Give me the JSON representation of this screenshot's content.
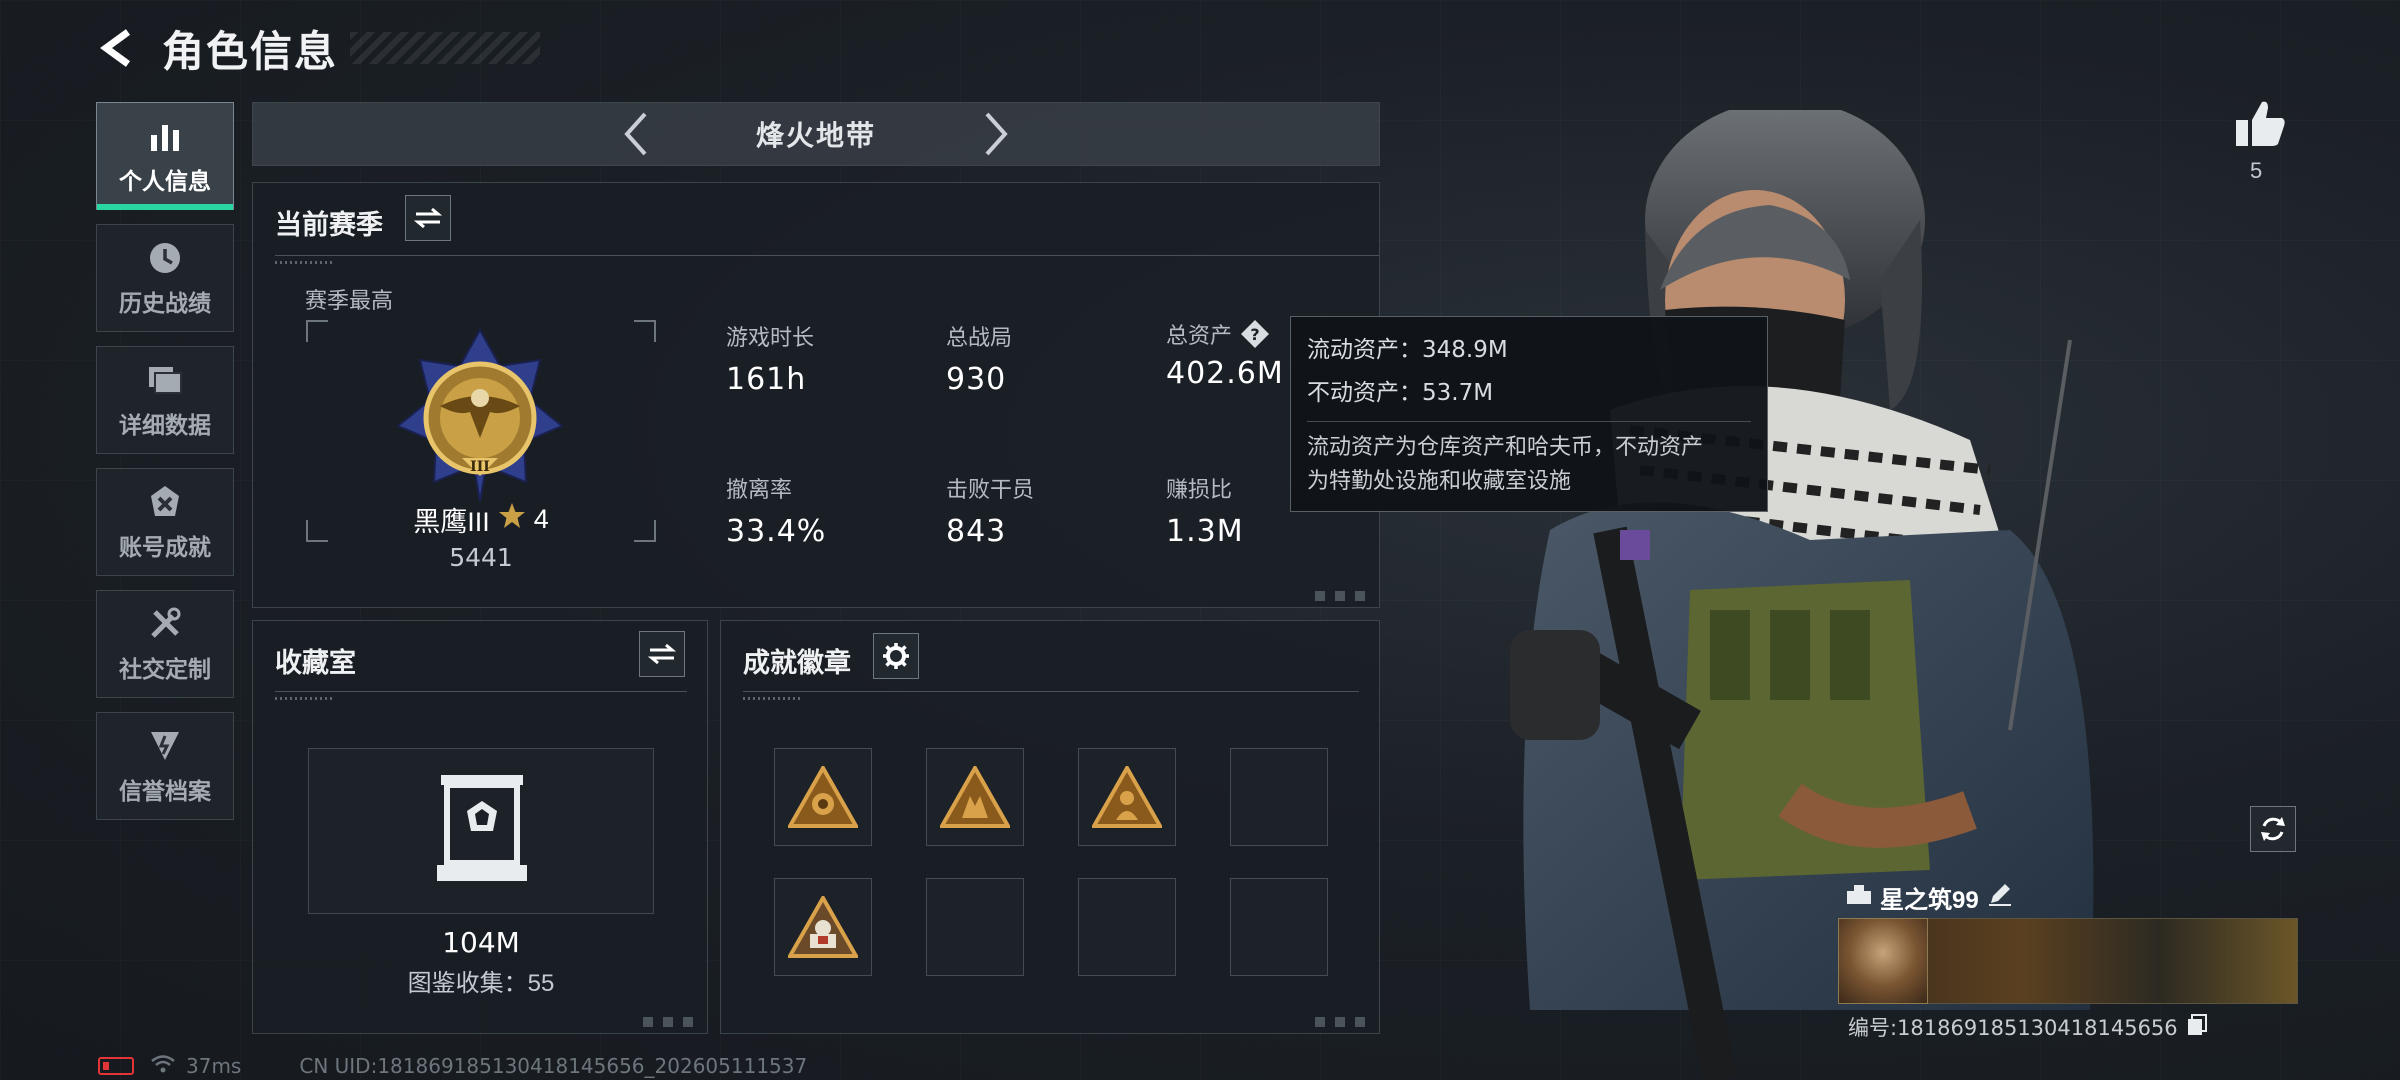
{
  "header": {
    "title": "角色信息"
  },
  "sidebar": {
    "items": [
      {
        "label": "个人信息",
        "icon": "bar-chart-icon",
        "active": true
      },
      {
        "label": "历史战绩",
        "icon": "history-clock-icon"
      },
      {
        "label": "详细数据",
        "icon": "folder-icon"
      },
      {
        "label": "账号成就",
        "icon": "achievement-icon"
      },
      {
        "label": "社交定制",
        "icon": "tools-icon"
      },
      {
        "label": "信誉档案",
        "icon": "shield-badge-icon"
      }
    ]
  },
  "mode": {
    "name": "烽火地带"
  },
  "season": {
    "title": "当前赛季",
    "best_label": "赛季最高",
    "rank_name": "黑鹰III",
    "rank_stars": "4",
    "rank_points": "5441",
    "stats": [
      {
        "label": "游戏时长",
        "value": "161h"
      },
      {
        "label": "总战局",
        "value": "930"
      },
      {
        "label": "总资产",
        "value": "402.6M"
      },
      {
        "label": "撤离率",
        "value": "33.4%"
      },
      {
        "label": "击败干员",
        "value": "843"
      },
      {
        "label": "赚损比",
        "value": "1.3M"
      }
    ]
  },
  "tooltip": {
    "liquid": "流动资产：348.9M",
    "fixed": "不动资产：53.7M",
    "desc_line1": "流动资产为仓库资产和哈夫币，不动资产",
    "desc_line2": "为特勤处设施和收藏室设施"
  },
  "collection": {
    "title": "收藏室",
    "value": "104M",
    "catalog": "图鉴收集：55"
  },
  "badges": {
    "title": "成就徽章"
  },
  "character": {
    "likes": "5",
    "player_name": "星之筑99",
    "player_id": "编号:1818691851304181456​56"
  },
  "footer": {
    "ping": "37ms",
    "uid": "CN UID:1818691851304181456​56_202605111537"
  },
  "colors": {
    "accent": "#27d6a0",
    "gold": "#c9a046",
    "battery_low": "#e23535"
  }
}
